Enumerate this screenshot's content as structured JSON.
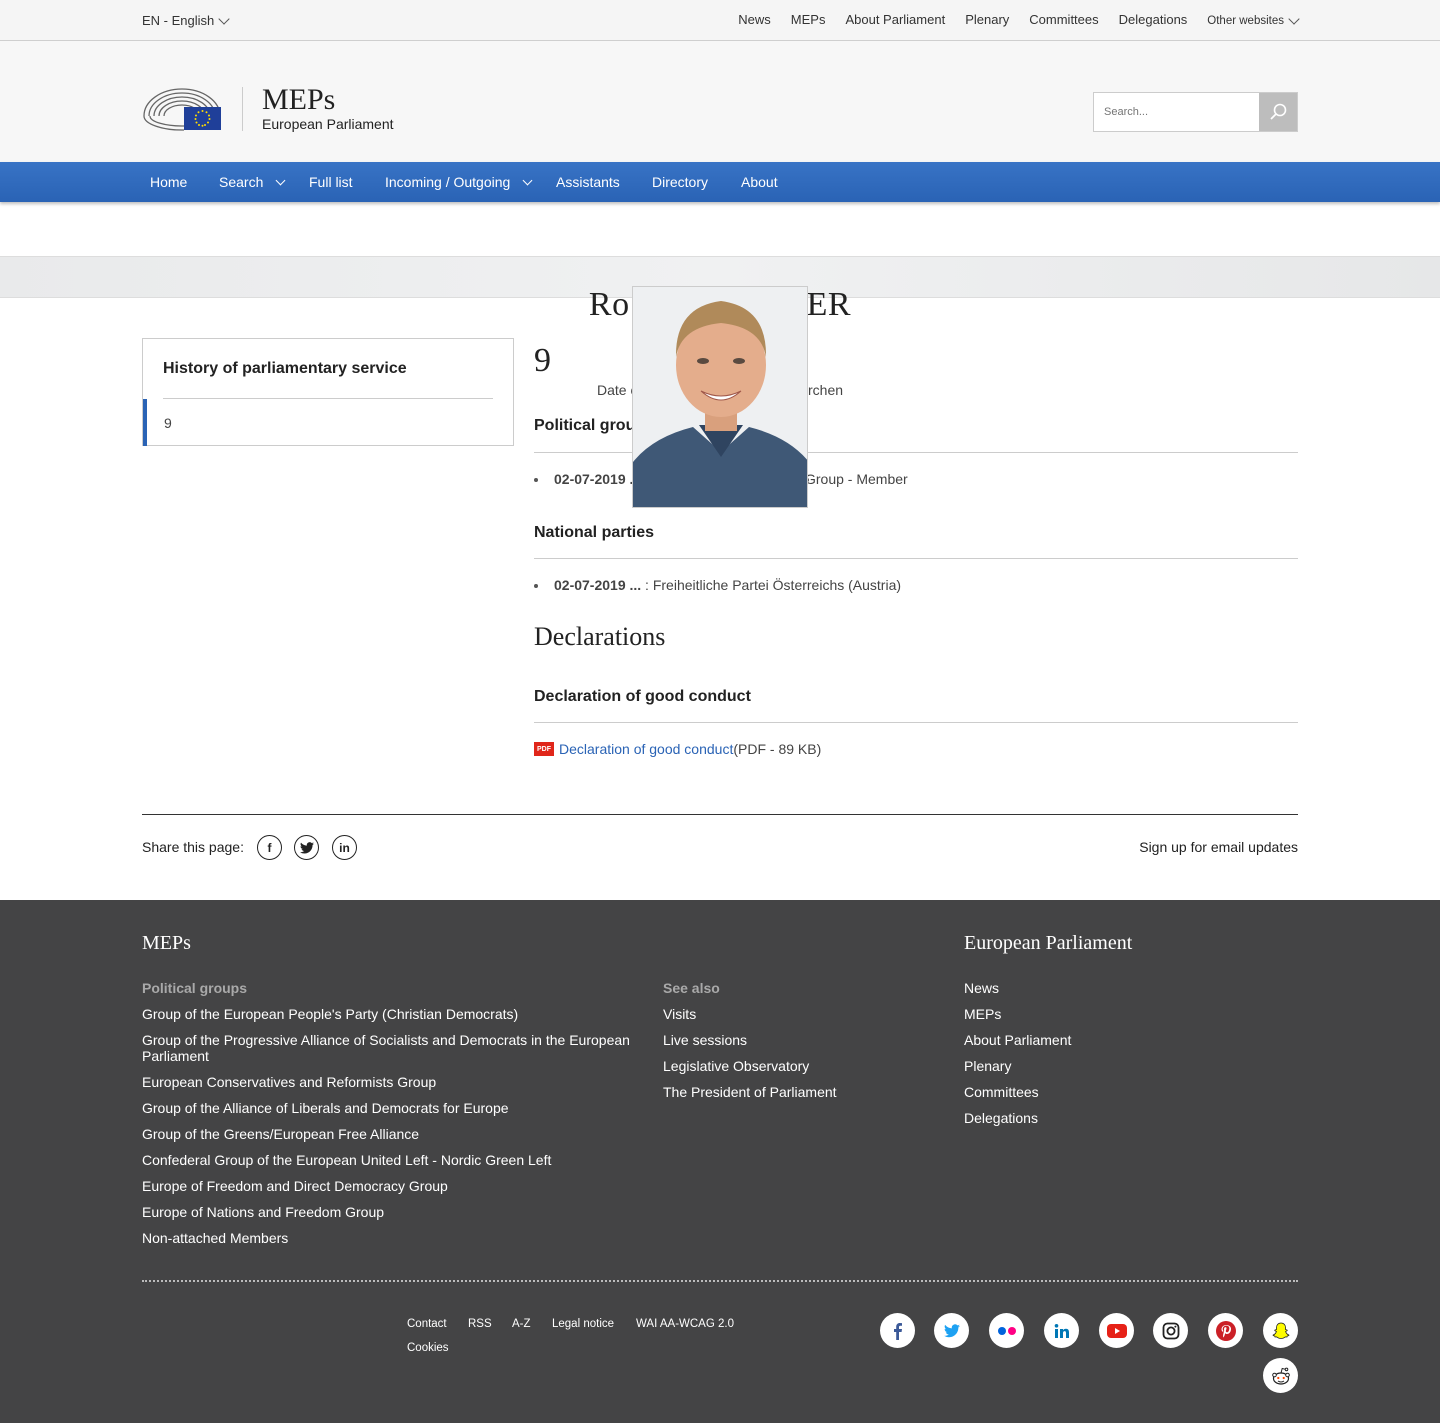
{
  "topbar": {
    "language": "EN - English",
    "links": [
      "News",
      "MEPs",
      "About Parliament",
      "Plenary",
      "Committees",
      "Delegations"
    ],
    "other_websites": "Other websites"
  },
  "header": {
    "title": "MEPs",
    "subtitle": "European Parliament",
    "search_placeholder": "Search..."
  },
  "mainnav": {
    "home": "Home",
    "search": "Search",
    "full_list": "Full list",
    "incoming_outgoing": "Incoming / Outgoing",
    "assistants": "Assistants",
    "directory": "Directory",
    "about": "About"
  },
  "mep": {
    "name_left": "Ro",
    "name_right": "ER",
    "term": "9",
    "dob_left": "Date o",
    "dob_right": "rchen"
  },
  "history": {
    "title": "History of parliamentary service",
    "items": [
      "9"
    ]
  },
  "political_groups": {
    "heading": "Political grou",
    "entry_date": "02-07-2019 .",
    "entry_text": "Group - Member"
  },
  "national_parties": {
    "heading": "National parties",
    "entry_date": "02-07-2019 ...",
    "entry_text": " : Freiheitliche Partei Österreichs (Austria)"
  },
  "declarations": {
    "heading": "Declarations",
    "subheading": "Declaration of good conduct",
    "pdf_badge": "PDF",
    "link_text": "Declaration of good conduct",
    "file_info": " (PDF - 89 KB)"
  },
  "share": {
    "label": "Share this page:",
    "facebook": "f",
    "linkedin": "in",
    "signup": "Sign up for email updates"
  },
  "footer": {
    "meps_title": "MEPs",
    "groups_heading": "Political groups",
    "groups": [
      "Group of the European People's Party (Christian Democrats)",
      "Group of the Progressive Alliance of Socialists and Democrats in the European Parliament",
      "European Conservatives and Reformists Group",
      "Group of the Alliance of Liberals and Democrats for Europe",
      "Group of the Greens/European Free Alliance",
      "Confederal Group of the European United Left - Nordic Green Left",
      "Europe of Freedom and Direct Democracy Group",
      "Europe of Nations and Freedom Group",
      "Non-attached Members"
    ],
    "see_also_heading": "See also",
    "see_also": [
      "Visits",
      "Live sessions",
      "Legislative Observatory",
      "The President of Parliament"
    ],
    "ep_title": "European Parliament",
    "ep_links": [
      "News",
      "MEPs",
      "About Parliament",
      "Plenary",
      "Committees",
      "Delegations"
    ],
    "bottom_links": [
      "Contact",
      "RSS",
      "A-Z",
      "Legal notice",
      "WAI AA-WCAG 2.0",
      "Cookies"
    ],
    "social_icons": [
      "facebook-icon",
      "twitter-icon",
      "flickr-icon",
      "linkedin-icon",
      "youtube-icon",
      "instagram-icon",
      "pinterest-icon",
      "snapchat-icon",
      "reddit-icon"
    ]
  }
}
